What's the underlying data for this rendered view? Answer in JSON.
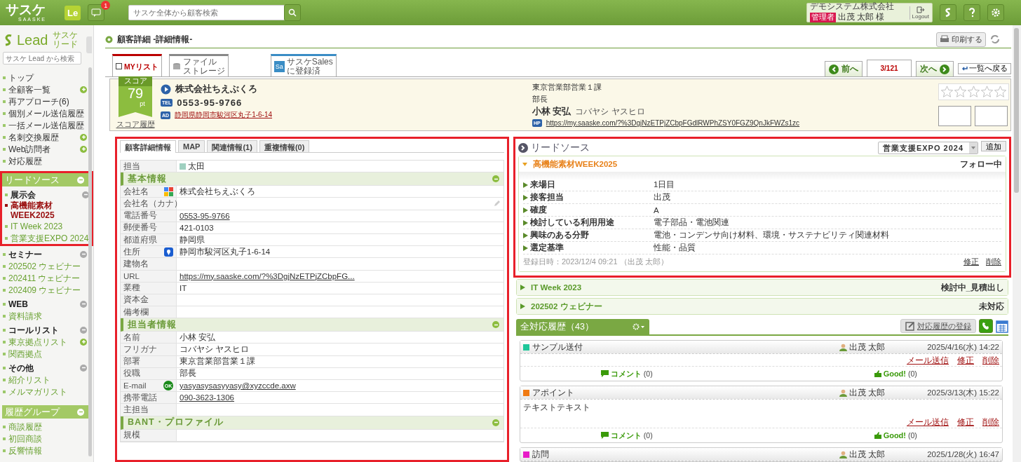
{
  "topbar": {
    "logo": "サスケ",
    "logo_caption": "SAASKE",
    "app_badge": "Le",
    "notification_count": "1",
    "search": {
      "placeholder": "サスケ全体から顧客検索"
    },
    "user": {
      "company": "デモシステム株式会社",
      "role": "管理者",
      "name": "出茂 太郎 様"
    },
    "logout": "Logout"
  },
  "sidebar": {
    "logo": "Lead",
    "logo_sub": [
      "サスケ",
      "リード"
    ],
    "search": {
      "placeholder": "サスケ Lead から検索"
    },
    "nav": [
      {
        "label": "トップ",
        "add": false
      },
      {
        "label": "全顧客一覧",
        "add": true
      },
      {
        "label": "再アプローチ(6)",
        "add": false
      },
      {
        "label": "個別メール送信履歴",
        "add": false
      },
      {
        "label": "一括メール送信履歴",
        "add": false
      },
      {
        "label": "名刺交換履歴",
        "add": true
      },
      {
        "label": "Web訪問者",
        "add": true
      },
      {
        "label": "対応履歴",
        "add": false
      }
    ],
    "groups": [
      {
        "title": "リードソース",
        "highlighted": true,
        "sections": [
          {
            "title": "展示会",
            "highlighted": true,
            "items": [
              {
                "label": "高機能素材WEEK2025",
                "selected": true,
                "add": false
              },
              {
                "label": "IT Week 2023",
                "selected": false,
                "add": false
              },
              {
                "label": "営業支援EXPO 2024",
                "selected": false,
                "add": false
              }
            ]
          },
          {
            "title": "セミナー",
            "highlighted": false,
            "items": [
              {
                "label": "202502 ウェビナー",
                "selected": false,
                "add": false
              },
              {
                "label": "202411 ウェビナー",
                "selected": false,
                "add": false
              },
              {
                "label": "202409 ウェビナー",
                "selected": false,
                "add": false
              }
            ]
          },
          {
            "title": "WEB",
            "highlighted": false,
            "items": [
              {
                "label": "資料請求",
                "selected": false,
                "add": false
              }
            ]
          },
          {
            "title": "コールリスト",
            "highlighted": false,
            "items": [
              {
                "label": "東京拠点リスト",
                "selected": false,
                "add": true
              },
              {
                "label": "関西拠点",
                "selected": false,
                "add": false
              }
            ]
          },
          {
            "title": "その他",
            "highlighted": false,
            "items": [
              {
                "label": "紹介リスト",
                "selected": false,
                "add": false
              },
              {
                "label": "メルマガリスト",
                "selected": false,
                "add": false
              }
            ]
          }
        ]
      },
      {
        "title": "履歴グループ",
        "highlighted": false,
        "items": [
          {
            "label": "商談履歴",
            "selected": false,
            "add": false
          },
          {
            "label": "初回商談",
            "selected": false,
            "add": false
          },
          {
            "label": "反響情報",
            "selected": false,
            "add": false
          }
        ]
      }
    ]
  },
  "page": {
    "title": "顧客詳細 -詳細情報-",
    "print": "印刷する"
  },
  "record_tabs": {
    "my_list": {
      "label": "MYリスト",
      "checked": false
    },
    "storage": [
      "ファイル",
      "ストレージ"
    ],
    "sales": {
      "badge": "Sa",
      "lines": [
        "サスケSales",
        "に登録済"
      ]
    }
  },
  "pager": {
    "prev": "前へ",
    "position": "3/121",
    "next": "次へ",
    "back": "一覧へ戻る"
  },
  "customer": {
    "score": {
      "label": "スコア",
      "value": "79",
      "unit": "pt",
      "history": "スコア履歴"
    },
    "company": "株式会社ちえぶくろ",
    "phone_badge": "TEL",
    "phone": "0553-95-9766",
    "address_badge": "AD",
    "address": "静岡県静岡市駿河区丸子1-6-14",
    "department": "東京営業部営業１課",
    "position": "部長",
    "name": "小林 安弘",
    "kana": "コバヤシ ヤスヒロ",
    "url_badge": "HP",
    "url": "https://my.saaske.com/?%3DgjNzETPjZCbpFGdlRWPhZSY0FGZ9QnJkFWZs1zc",
    "stars": 0
  },
  "detail": {
    "highlighted": true,
    "tabs": [
      {
        "label": "顧客詳細情報",
        "selected": true
      },
      {
        "label": "MAP",
        "selected": false
      },
      {
        "label": "関連情報(1)",
        "selected": false
      },
      {
        "label": "重複情報(0)",
        "selected": false
      }
    ],
    "owner": {
      "label": "担当",
      "value": "太田"
    },
    "sections": [
      {
        "title": "基本情報",
        "rows": [
          {
            "label": "会社名",
            "value": "株式会社ちえぶくろ",
            "kind": "searchable"
          },
          {
            "label": "会社名（カナ）",
            "kind": "editable"
          },
          {
            "label": "電話番号",
            "value": "0553-95-9766",
            "kind": "link"
          },
          {
            "label": "郵便番号",
            "value": "421-0103",
            "kind": "text"
          },
          {
            "label": "都道府県",
            "value": "静岡県",
            "kind": "text"
          },
          {
            "label": "住所",
            "value": "静岡市駿河区丸子1-6-14",
            "kind": "address"
          },
          {
            "label": "建物名",
            "kind": "text"
          },
          {
            "label": "URL",
            "value": "https://my.saaske.com/?%3DgjNzETPjZCbpFG...",
            "kind": "link"
          },
          {
            "label": "業種",
            "value": "IT",
            "kind": "text"
          },
          {
            "label": "資本金",
            "kind": "text"
          },
          {
            "label": "備考欄",
            "kind": "text"
          }
        ]
      },
      {
        "title": "担当者情報",
        "rows": [
          {
            "label": "名前",
            "value": "小林 安弘",
            "kind": "text"
          },
          {
            "label": "フリガナ",
            "value": "コバヤシ ヤスヒロ",
            "kind": "text"
          },
          {
            "label": "部署",
            "value": "東京営業部営業１課",
            "kind": "text"
          },
          {
            "label": "役職",
            "value": "部長",
            "kind": "text"
          },
          {
            "label": "E-mail",
            "value": "yasyasysasyyasy@xyzccde.axw",
            "kind": "mail",
            "badge": "OK"
          },
          {
            "label": "携帯電話",
            "value": "090-3623-1306",
            "kind": "link"
          },
          {
            "label": "主担当",
            "kind": "text"
          }
        ]
      },
      {
        "title": "BANT・プロファイル",
        "rows": [
          {
            "label": "規模",
            "kind": "text"
          }
        ]
      }
    ]
  },
  "lead_source": {
    "highlighted": true,
    "title": "リードソース",
    "select": "営業支援EXPO 2024",
    "add": "追加",
    "entries": [
      {
        "title": "高機能素材WEEK2025",
        "status": "フォロー中",
        "expanded": true,
        "fields": [
          {
            "label": "来場日",
            "value": "1日目"
          },
          {
            "label": "接客担当",
            "value": "出茂"
          },
          {
            "label": "確度",
            "value": "A"
          },
          {
            "label": "検討している利用用途",
            "value": "電子部品・電池関連"
          },
          {
            "label": "興味のある分野",
            "value": "電池・コンデンサ向け材料、環境・サステナビリティ関連材料"
          },
          {
            "label": "選定基準",
            "value": "性能・品質"
          }
        ],
        "footer": "登録日時：2023/12/4 09:21 （出茂 太郎）",
        "actions": [
          "修正",
          "削除"
        ]
      },
      {
        "title": "IT Week 2023",
        "status": "検討中_見積出し",
        "expanded": false
      },
      {
        "title": "202502 ウェビナー",
        "status": "未対応",
        "expanded": false
      }
    ]
  },
  "history": {
    "tab": "全対応履歴（43）",
    "register": "対応履歴の登録",
    "entries": [
      {
        "type": "サンプル送付",
        "color": "#1fc79a",
        "user": "出茂 太郎",
        "datetime": "2025/4/16(水) 14:22",
        "actions": [
          "メール送信",
          "修正",
          "削除"
        ],
        "comment": "コメント",
        "comment_count": "(0)",
        "good": "Good!",
        "good_count": "(0)"
      },
      {
        "type": "アポイント",
        "color": "#f07a12",
        "user": "出茂 太郎",
        "datetime": "2025/3/13(木) 15:22",
        "body": "テキストテキスト",
        "actions": [
          "メール送信",
          "修正",
          "削除"
        ],
        "comment": "コメント",
        "comment_count": "(0)",
        "good": "Good!",
        "good_count": "(0)"
      },
      {
        "type": "訪問",
        "color": "#e81cc8",
        "user": "出茂 太郎",
        "datetime": "2025/1/28(火) 16:47"
      }
    ]
  }
}
